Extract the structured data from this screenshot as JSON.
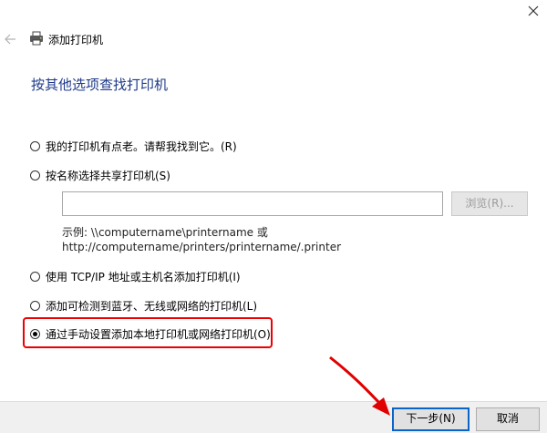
{
  "window": {
    "close_glyph": "✕"
  },
  "header": {
    "back_glyph": "←",
    "title": "添加打印机"
  },
  "heading": "按其他选项查找打印机",
  "options": [
    {
      "label": "我的打印机有点老。请帮我找到它。(R)",
      "checked": false
    },
    {
      "label": "按名称选择共享打印机(S)",
      "checked": false
    },
    {
      "label": "使用 TCP/IP 地址或主机名添加打印机(I)",
      "checked": false
    },
    {
      "label": "添加可检测到蓝牙、无线或网络的打印机(L)",
      "checked": false
    },
    {
      "label": "通过手动设置添加本地打印机或网络打印机(O)",
      "checked": true
    }
  ],
  "shared_printer": {
    "input_value": "",
    "browse_label": "浏览(R)...",
    "example_line1": "示例: \\\\computername\\printername 或",
    "example_line2": "http://computername/printers/printername/.printer"
  },
  "footer": {
    "next_label": "下一步(N)",
    "cancel_label": "取消"
  },
  "colors": {
    "heading": "#1e3a8a",
    "highlight": "#e00000",
    "arrow": "#e00000",
    "default_button_border": "#0a64c8"
  }
}
